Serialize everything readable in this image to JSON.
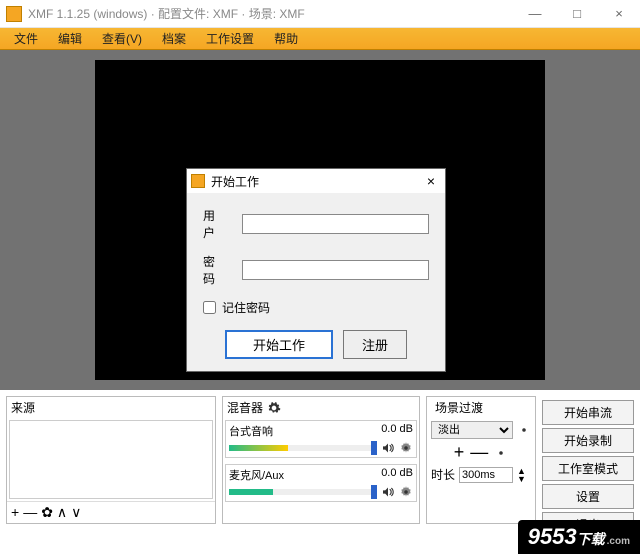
{
  "window": {
    "title": "XMF 1.1.25 (windows) · 配置文件: XMF · 场景: XMF",
    "minimize": "—",
    "maximize": "□",
    "close": "×"
  },
  "menu": {
    "file": "文件",
    "edit": "编辑",
    "view": "查看(V)",
    "archive": "档案",
    "work_settings": "工作设置",
    "help": "帮助"
  },
  "panels": {
    "sources_title": "来源",
    "mixer_title": "混音器",
    "transitions_title": "场景过渡"
  },
  "sources_toolbar": {
    "add": "+",
    "remove": "—",
    "settings": "✿",
    "up": "∧",
    "down": "∨"
  },
  "mixer": {
    "channel1": {
      "name": "台式音响",
      "level": "0.0 dB"
    },
    "channel2": {
      "name": "麦克风/Aux",
      "level": "0.0 dB"
    }
  },
  "transitions": {
    "mode": "淡出",
    "plus": "+",
    "minus": "—",
    "duration_label": "时长",
    "duration_value": "300ms"
  },
  "buttons": {
    "start_stream": "开始串流",
    "start_record": "开始录制",
    "studio_mode": "工作室模式",
    "settings": "设置",
    "exit": "退出"
  },
  "dialog": {
    "title": "开始工作",
    "close": "×",
    "user_label": "用户",
    "pass_label": "密码",
    "remember": "记住密码",
    "primary_btn": "开始工作",
    "secondary_btn": "注册"
  },
  "watermark": {
    "main": "9553",
    "sub": "下载",
    "dotcom": ".com"
  }
}
